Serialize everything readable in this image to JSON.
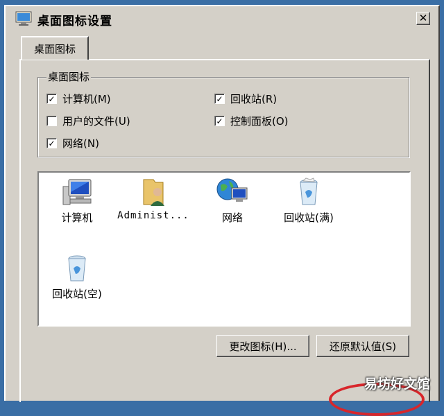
{
  "window": {
    "title": "桌面图标设置",
    "close_label": "✕"
  },
  "tabs": [
    {
      "label": "桌面图标"
    }
  ],
  "group": {
    "legend": "桌面图标",
    "checkboxes": [
      {
        "label": "计算机(M)",
        "checked": true
      },
      {
        "label": "回收站(R)",
        "checked": true
      },
      {
        "label": "用户的文件(U)",
        "checked": false
      },
      {
        "label": "控制面板(O)",
        "checked": true
      },
      {
        "label": "网络(N)",
        "checked": true
      }
    ]
  },
  "icons": [
    {
      "label": "计算机",
      "icon": "computer-icon"
    },
    {
      "label": "Administ...",
      "icon": "user-folder-icon"
    },
    {
      "label": "网络",
      "icon": "network-icon"
    },
    {
      "label": "回收站(满)",
      "icon": "recycle-bin-full-icon"
    },
    {
      "label": "回收站(空)",
      "icon": "recycle-bin-empty-icon"
    }
  ],
  "buttons": {
    "change_icon": "更改图标(H)...",
    "restore_default": "还原默认值(S)"
  },
  "watermark": "易坊好文馆",
  "colors": {
    "desktop": "#3a6ea5",
    "face": "#d4d0c8",
    "highlight_circle": "#d8262b"
  }
}
